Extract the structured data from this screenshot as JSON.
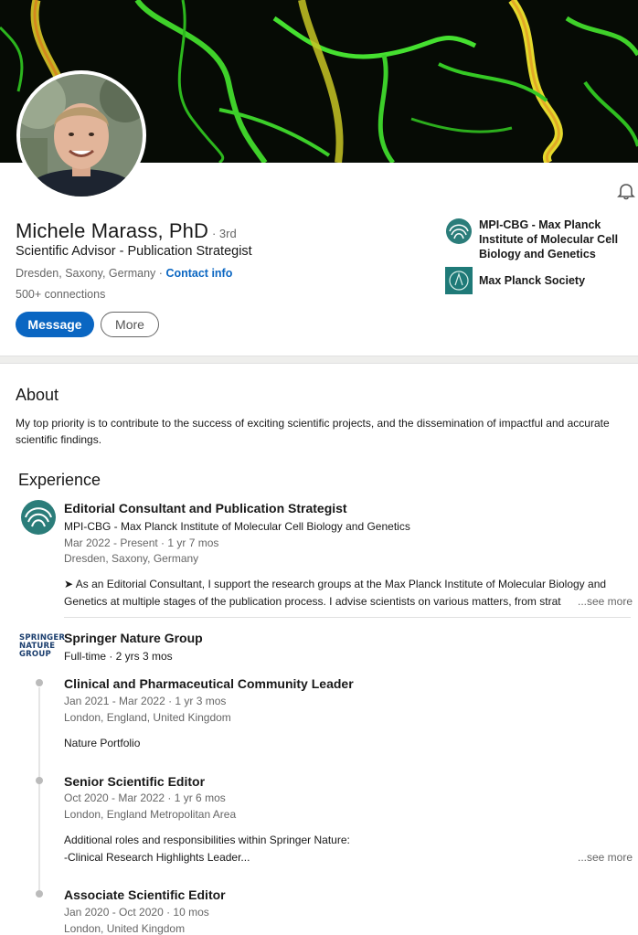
{
  "profile": {
    "name": "Michele Marass, PhD",
    "degree": "· 3rd",
    "headline": "Scientific Advisor - Publication Strategist",
    "location": "Dresden, Saxony, Germany ·",
    "contact_label": "Contact info",
    "connections": "500+ connections",
    "message_label": "Message",
    "more_label": "More"
  },
  "organizations": [
    {
      "name": "MPI-CBG - Max Planck Institute of Molecular Cell Biology and Genetics",
      "line1": "MPI-CBG - Max Planck",
      "line2": "Institute of Molecular Cell",
      "line3": "Biology and Genetics",
      "icon": "mpi-cbg-logo"
    },
    {
      "name": "Max Planck Society",
      "icon": "max-planck-society-logo"
    }
  ],
  "about": {
    "title": "About",
    "text": "My top priority is to contribute to the success of exciting scientific projects, and the dissemination of impactful and accurate scientific findings."
  },
  "experience": {
    "title": "Experience",
    "job1": {
      "title": "Editorial Consultant and Publication Strategist",
      "company": "MPI-CBG - Max Planck Institute of Molecular Cell Biology and Genetics",
      "dates": "Mar 2022 - Present · 1 yr 7 mos",
      "location": "Dresden, Saxony, Germany",
      "desc_line1": "➤ As an Editorial Consultant, I support the research groups at the Max Planck Institute of Molecular Biology and",
      "desc_line2": "Genetics at multiple stages of the publication process. I advise scientists on various matters, from strat",
      "see_more": "...see more"
    },
    "company2": {
      "name": "Springer Nature Group",
      "summary": "Full-time · 2 yrs 3 mos",
      "logo_line1": "SPRINGER",
      "logo_line2": "NATURE",
      "logo_line3": "GROUP"
    },
    "role1": {
      "title": "Clinical and Pharmaceutical Community Leader",
      "dates": "Jan 2021 - Mar 2022 · 1 yr 3 mos",
      "location": "London, England, United Kingdom",
      "note": "Nature Portfolio"
    },
    "role2": {
      "title": "Senior Scientific Editor",
      "dates": "Oct 2020 - Mar 2022 · 1 yr 6 mos",
      "location": "London, England Metropolitan Area",
      "desc_line1": "Additional roles and responsibilities within Springer Nature:",
      "desc_line2": "-Clinical Research Highlights Leader...",
      "see_more": "...see more"
    },
    "role3": {
      "title": "Associate Scientific Editor",
      "dates": "Jan 2020 - Oct 2020 · 10 mos",
      "location": "London, United Kingdom"
    }
  },
  "colors": {
    "accent": "#0a66c2",
    "muted": "#666666",
    "mpi_teal": "#1f7a78"
  }
}
